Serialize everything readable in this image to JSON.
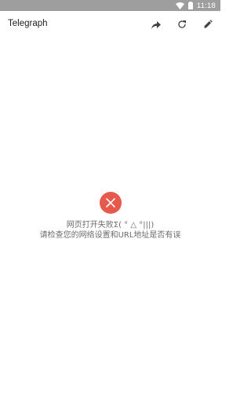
{
  "status_bar": {
    "time": "11:18",
    "icons": [
      "wifi-icon",
      "battery-icon"
    ]
  },
  "app_bar": {
    "title": "Telegraph",
    "actions": [
      {
        "name": "share",
        "icon": "share-icon"
      },
      {
        "name": "reload",
        "icon": "reload-icon"
      },
      {
        "name": "edit",
        "icon": "pencil-icon"
      }
    ]
  },
  "error": {
    "icon": "close-icon",
    "line1": "网页打开失败Σ( ° △ °|||)",
    "line2": "请检查您的网络设置和URL地址是否有误"
  },
  "colors": {
    "status_bar": "#9e9e9e",
    "error_circle": "#e65a4e",
    "message_text": "#6b6b6b",
    "title_text": "#212121",
    "icon": "#424242"
  }
}
